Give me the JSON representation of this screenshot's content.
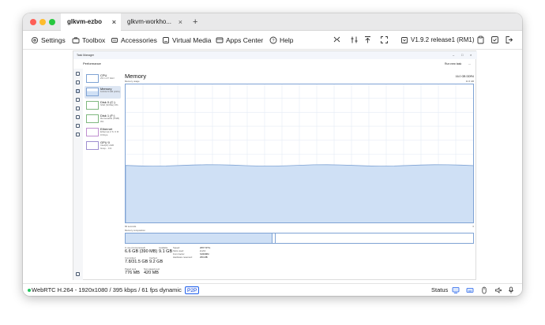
{
  "browser": {
    "tabs": [
      {
        "label": "glkvm-ezbo",
        "close": "×"
      },
      {
        "label": "glkvm-workho...",
        "close": "×"
      }
    ],
    "new_tab": "+"
  },
  "menu": {
    "items": [
      {
        "label": "Settings",
        "icon": "gear-icon"
      },
      {
        "label": "Toolbox",
        "icon": "toolbox-icon"
      },
      {
        "label": "Accessories",
        "icon": "accessories-icon"
      },
      {
        "label": "Virtual Media",
        "icon": "virtual-media-icon"
      },
      {
        "label": "Apps Center",
        "icon": "apps-icon"
      },
      {
        "label": "Help",
        "icon": "help-icon"
      }
    ],
    "version": "V1.9.2 release1 (RM1)"
  },
  "task_manager": {
    "window_title": "Task Manager",
    "controls": {
      "minimize": "–",
      "maximize": "□",
      "close": "×"
    },
    "header": "Performance",
    "run_task": "Run new task",
    "more": "...",
    "sidebar": [
      {
        "name": "CPU",
        "sub": "2% 1.47 GHz"
      },
      {
        "name": "Memory",
        "sub": "6.6/31.5 GB (21%)"
      },
      {
        "name": "Disk 0 (C:)",
        "sub": "SSD (NVMe) 0%"
      },
      {
        "name": "Disk 1 (F:)",
        "sub": "Removable (USB) 0%"
      },
      {
        "name": "Ethernet",
        "sub": "Ethernet 2 S: 0 R: 0 Kbps"
      },
      {
        "name": "GPU 0",
        "sub": "Intel(R) UHD Grap... 1%"
      }
    ],
    "memory": {
      "title": "Memory",
      "size": "16.0 GB DDR4",
      "usage_label": "Memory usage",
      "max_label": "31.5 GB",
      "time_left": "60 seconds",
      "time_right": "0",
      "composition_label": "Memory composition",
      "usage_fraction": 0.42,
      "stats": [
        {
          "label": "In use (Compressed)",
          "value": "6.6 GB (390 MB)"
        },
        {
          "label": "Available",
          "value": "9.1 GB"
        },
        {
          "label": "Committed",
          "value": "7.8/31.5 GB"
        },
        {
          "label": "Cached",
          "value": "9.2 GB"
        },
        {
          "label": "Paged pool",
          "value": "776 MB"
        },
        {
          "label": "Non-paged pool",
          "value": "420 MB"
        }
      ],
      "specs": [
        {
          "label": "Speed:",
          "value": "2667 MT/s"
        },
        {
          "label": "Slots used:",
          "value": "2 of 2"
        },
        {
          "label": "Form factor:",
          "value": "SODIMM"
        },
        {
          "label": "Hardware reserved:",
          "value": "259 MB"
        }
      ]
    }
  },
  "status": {
    "stream": "WebRTC H.264 - 1920x1080 / 395 kbps / 61 fps dynamic",
    "badge": "P2P",
    "status_label": "Status"
  },
  "colors": {
    "accent": "#2563eb",
    "graph_fill": "#cfe0f5",
    "graph_line": "#7fa3d4",
    "connected": "#22c55e"
  }
}
